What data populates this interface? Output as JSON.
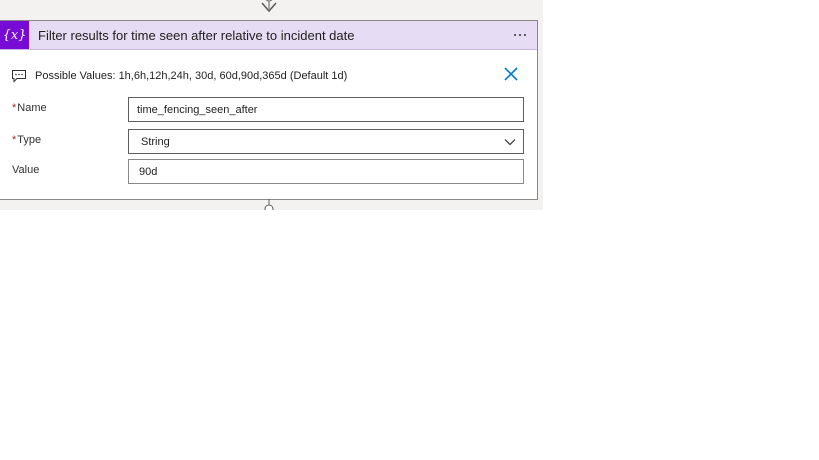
{
  "card": {
    "title": "Filter results for time seen after relative to incident date",
    "icon_name": "variable-icon",
    "icon_glyph": "{x}",
    "accent_color": "#770bd6",
    "header_color": "#e6dcf3",
    "more_icon": "more-options-icon"
  },
  "comment": {
    "icon_name": "comment-icon",
    "text": "Possible Values: 1h,6h,12h,24h, 30d, 60d,90d,365d (Default 1d)",
    "close_icon": "close-icon",
    "close_color": "#0078d4"
  },
  "fields": {
    "name": {
      "label": "Name",
      "required_mark": "*",
      "value": "time_fencing_seen_after"
    },
    "type": {
      "label": "Type",
      "required_mark": "*",
      "value": "String",
      "dropdown_icon": "chevron-down-icon"
    },
    "value": {
      "label": "Value",
      "value": "90d"
    }
  }
}
